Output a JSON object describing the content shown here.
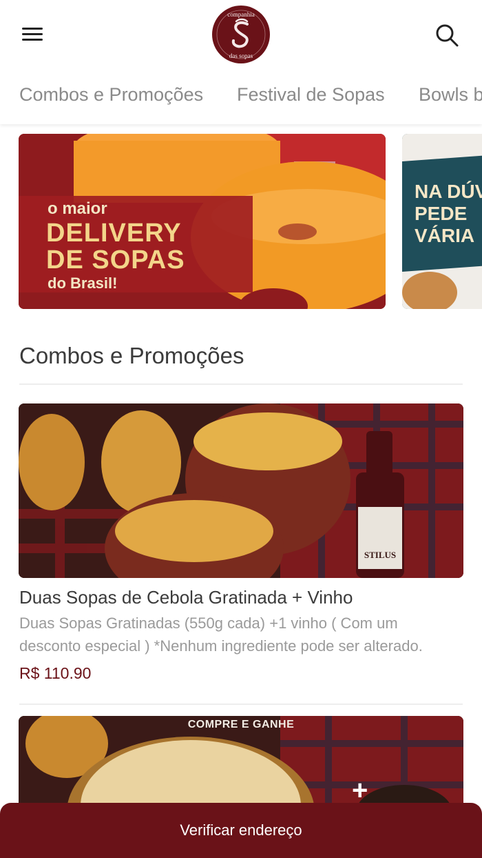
{
  "header": {
    "menu_icon": "hamburger-menu-icon",
    "logo_text": "companhia das sopas",
    "search_icon": "search-icon"
  },
  "tabs": [
    {
      "label": "Combos e Promoções"
    },
    {
      "label": "Festival de Sopas"
    },
    {
      "label": "Bowls b"
    }
  ],
  "banners": [
    {
      "line_small": "o maior",
      "line_big_1": "DELIVERY",
      "line_big_2": "DE SOPAS",
      "line_tail": "do Brasil!"
    },
    {
      "line_1": "NA DÚV",
      "line_2": "PEDE",
      "line_3": "VÁRIA"
    }
  ],
  "section": {
    "title": "Combos e Promoções"
  },
  "products": [
    {
      "name": "Duas Sopas de Cebola Gratinada + Vinho",
      "description": "Duas Sopas Gratinadas (550g cada) +1 vinho ( Com um desconto especial ) *Nenhum ingrediente pode ser alterado.",
      "price": "R$ 110.90",
      "wine_label": "STILUS"
    },
    {
      "promo_label": "COMPRE E GANHE",
      "plus": "+"
    }
  ],
  "cta": {
    "label": "Verificar endereço"
  },
  "colors": {
    "brand": "#6a1218",
    "price": "#6b1218",
    "tab_text": "#8a8a8a"
  }
}
